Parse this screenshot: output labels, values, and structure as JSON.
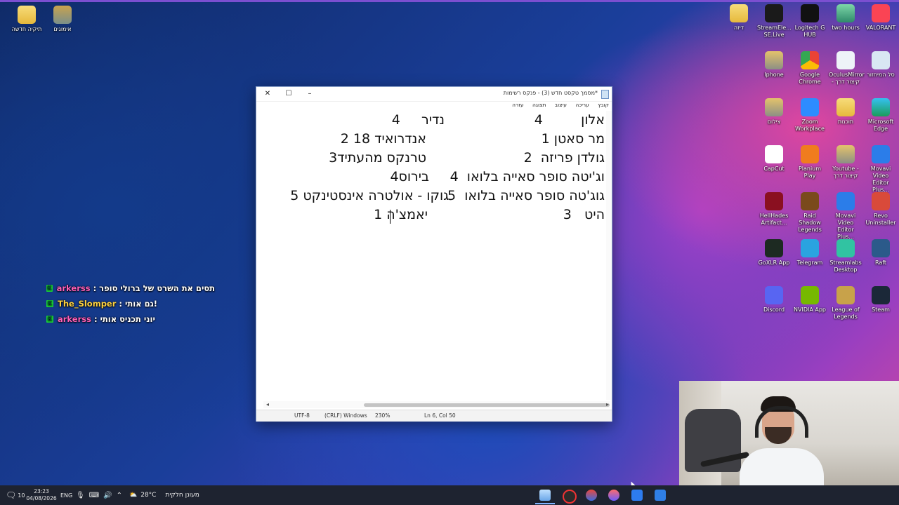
{
  "desktop": {
    "left_icons": [
      {
        "label": "תיקיה חדשה",
        "icon": "folder-icon"
      },
      {
        "label": "אימוגים",
        "icon": "archive-folder-icon"
      }
    ],
    "right_icons": [
      {
        "label": "דיזה",
        "icon": "folder-icon"
      },
      {
        "label": "StreamEle... SE.Live",
        "icon": "streamelements-icon"
      },
      {
        "label": "Logitech G HUB",
        "icon": "logitech-g-icon"
      },
      {
        "label": "two hours",
        "icon": "image-thumbnail-icon"
      },
      {
        "label": "VALORANT",
        "icon": "valorant-icon"
      },
      {
        "label": "Iphone",
        "icon": "archive-folder-icon"
      },
      {
        "label": "Google Chrome",
        "icon": "chrome-icon"
      },
      {
        "label": "OculusMirror - קיצור דרך",
        "icon": "oculus-mirror-icon"
      },
      {
        "label": "סל המיחזור",
        "icon": "recycle-bin-icon"
      },
      {
        "label": "צילום",
        "icon": "archive-folder-icon"
      },
      {
        "label": "Zoom Workplace",
        "icon": "zoom-icon"
      },
      {
        "label": "תוכנות",
        "icon": "folder-icon"
      },
      {
        "label": "Microsoft Edge",
        "icon": "edge-icon"
      },
      {
        "label": "CapCut",
        "icon": "capcut-icon"
      },
      {
        "label": "Planium Play",
        "icon": "planium-play-icon"
      },
      {
        "label": "Youtube - קיצור דרך",
        "icon": "archive-folder-icon"
      },
      {
        "label": "Movavi Video Editor Plus...",
        "icon": "movavi-icon"
      },
      {
        "label": "HellHades Artifact...",
        "icon": "hellhades-icon"
      },
      {
        "label": "Raid Shadow Legends",
        "icon": "raid-shadow-legends-icon"
      },
      {
        "label": "Movavi Video Editor Plus...",
        "icon": "movavi-icon"
      },
      {
        "label": "Revo Uninstaller",
        "icon": "revo-uninstaller-icon"
      },
      {
        "label": "GoXLR App",
        "icon": "goxlr-icon"
      },
      {
        "label": "Telegram",
        "icon": "telegram-icon"
      },
      {
        "label": "Streamlabs Desktop",
        "icon": "streamlabs-icon"
      },
      {
        "label": "Raft",
        "icon": "raft-icon"
      },
      {
        "label": "Discord",
        "icon": "discord-icon"
      },
      {
        "label": "NVIDIA App",
        "icon": "nvidia-icon"
      },
      {
        "label": "League of Legends",
        "icon": "league-of-legends-icon"
      },
      {
        "label": "Steam",
        "icon": "steam-icon"
      }
    ]
  },
  "notepad": {
    "title": "*מסמך טקסט חדש (3) - פנקס רשימות",
    "menu": [
      "קובץ",
      "עריכה",
      "עיצוב",
      "תצוגה",
      "עזרה"
    ],
    "lines": [
      {
        "col1": "אלון         4",
        "col2": "נדיר     4"
      },
      {
        "col1": "מר סאטן 1",
        "col2": "אנדרואיד 18 2"
      },
      {
        "col1": "גולדן פריזה  2",
        "col2": "טרנקס מהעתיד3"
      },
      {
        "col1": "וג'יטה סופר סאייה בלואו  4",
        "col2": "בירוס4"
      },
      {
        "col1": "גוג'טה סופר סאייה בלואו  5",
        "col2": "גוקו - אולטרה אינסטינקט 5"
      },
      {
        "col1": "היט   3",
        "col2": "יאמצ'ה 1"
      }
    ],
    "status": {
      "position": "Ln 6, Col 50",
      "zoom": "230%",
      "line_ending": "(CRLF) Windows",
      "encoding": "UTF-8"
    }
  },
  "chat": [
    {
      "user": "arkerss",
      "user_color": "#ff5fb8",
      "message": ": תסים את השרט של ברולי סופר"
    },
    {
      "user": "The_Slomper",
      "user_color": "#ffd23f",
      "message": ": גם אותי!"
    },
    {
      "user": "arkerss",
      "user_color": "#ff5fb8",
      "message": ": יוני תכניס אותי"
    }
  ],
  "taskbar": {
    "notification_count": "10",
    "time": "23:23",
    "date": "04/08/2026",
    "language": "ENG",
    "weather_temp": "28°C",
    "weather_text": "מעונן חלקית"
  },
  "colors": {
    "chat_badge": "#1bd43a",
    "taskbar_bg": "#1e2330"
  }
}
